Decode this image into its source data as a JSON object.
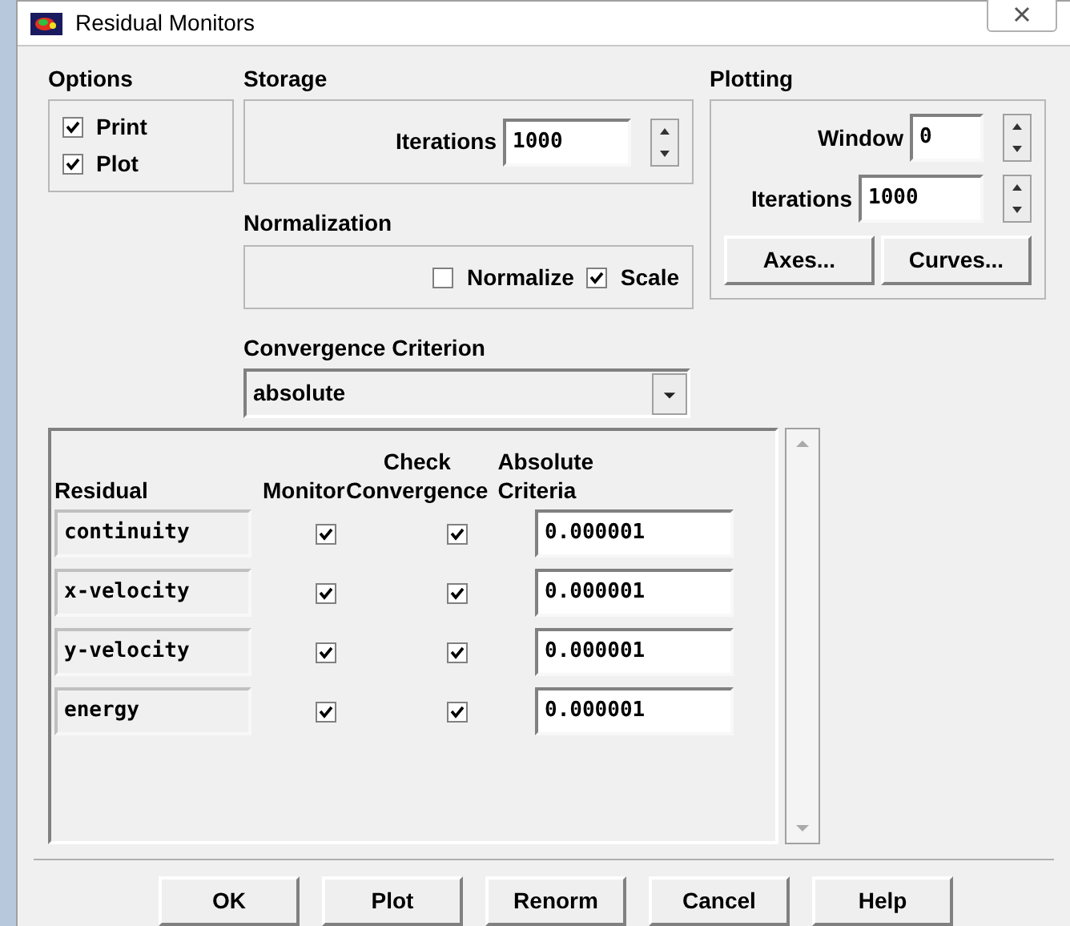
{
  "window": {
    "title": "Residual Monitors"
  },
  "options": {
    "title": "Options",
    "items": [
      {
        "label": "Print",
        "checked": true
      },
      {
        "label": "Plot",
        "checked": true
      }
    ]
  },
  "storage": {
    "title": "Storage",
    "iterations_label": "Iterations",
    "iterations": "1000"
  },
  "normalization": {
    "title": "Normalization",
    "items": [
      {
        "label": "Normalize",
        "checked": false
      },
      {
        "label": "Scale",
        "checked": true
      }
    ]
  },
  "convergence": {
    "title": "Convergence Criterion",
    "value": "absolute"
  },
  "plotting": {
    "title": "Plotting",
    "window_label": "Window",
    "window": "0",
    "iterations_label": "Iterations",
    "iterations": "1000",
    "buttons": [
      "Axes...",
      "Curves..."
    ]
  },
  "table": {
    "columns": [
      "Residual",
      "Monitor",
      "Check Convergence",
      "Absolute Criteria"
    ],
    "rows": [
      {
        "residual": "continuity",
        "monitor": true,
        "check_convergence": true,
        "criteria": "0.000001"
      },
      {
        "residual": "x-velocity",
        "monitor": true,
        "check_convergence": true,
        "criteria": "0.000001"
      },
      {
        "residual": "y-velocity",
        "monitor": true,
        "check_convergence": true,
        "criteria": "0.000001"
      },
      {
        "residual": "energy",
        "monitor": true,
        "check_convergence": true,
        "criteria": "0.000001"
      }
    ]
  },
  "buttons": [
    "OK",
    "Plot",
    "Renorm",
    "Cancel",
    "Help"
  ]
}
